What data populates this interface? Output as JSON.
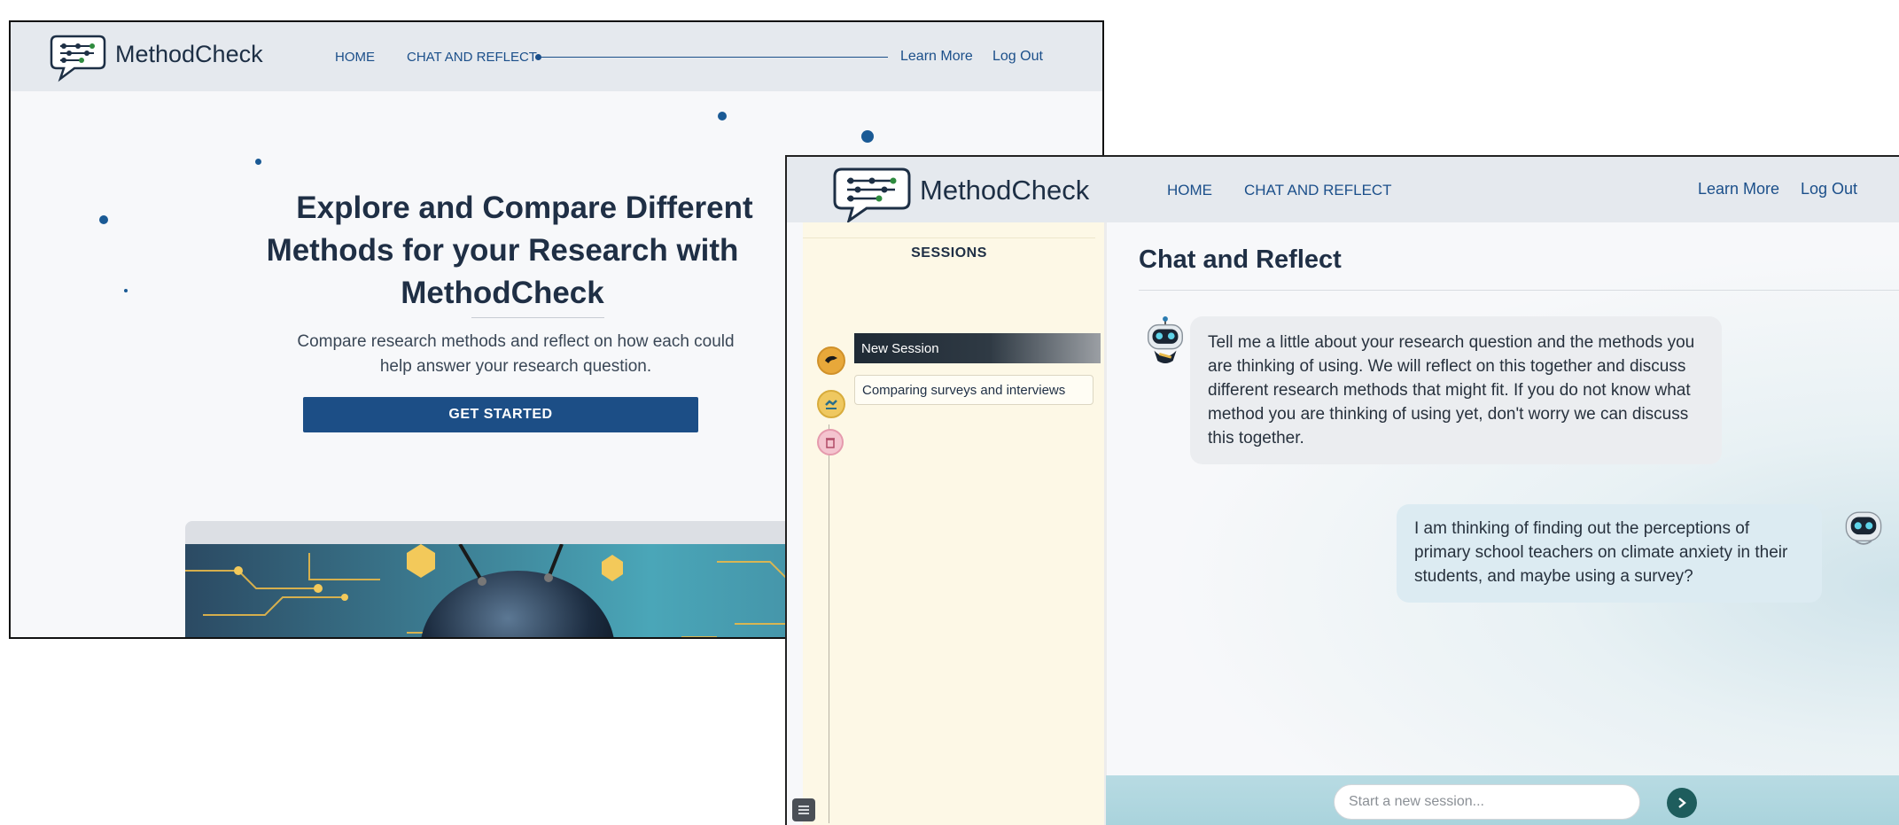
{
  "home": {
    "brand": "MethodCheck",
    "nav": {
      "home": "HOME",
      "chat": "CHAT AND REFLECT",
      "learn_more": "Learn More",
      "logout": "Log Out"
    },
    "hero": {
      "title_line1": "Explore and Compare Different",
      "title_line2": "Methods for your Research with",
      "title_line3": "MethodCheck",
      "subtitle_line1": "Compare research methods and reflect on how each could",
      "subtitle_line2": "help answer your research question.",
      "cta": "GET STARTED"
    }
  },
  "chat": {
    "brand": "MethodCheck",
    "nav": {
      "home": "HOME",
      "chat": "CHAT AND REFLECT",
      "learn_more": "Learn More",
      "logout": "Log Out"
    },
    "sidebar": {
      "title": "SESSIONS",
      "sessions": [
        {
          "label": "New Session",
          "active": true
        },
        {
          "label": "Comparing surveys and interviews",
          "active": false
        }
      ]
    },
    "title": "Chat and Reflect",
    "messages": [
      {
        "role": "bot",
        "text": "Tell me a little about your research question and the methods you are thinking of using. We will reflect on this together and discuss different research methods that might fit. If you do not know what method you are thinking of using yet, don't worry we can discuss this together."
      },
      {
        "role": "user",
        "text": "I am thinking of finding out the perceptions of primary school teachers on climate anxiety in their students, and maybe using a survey?"
      }
    ],
    "input": {
      "placeholder": "Start a new session..."
    }
  },
  "colors": {
    "brand_blue": "#1c4e86",
    "nav_link": "#1b4f8a",
    "nav_bg": "#e5e9ee",
    "sidebar_bg": "#fdf8e6",
    "input_bar": "#a9d3dc",
    "send_button": "#1e5d5d"
  }
}
